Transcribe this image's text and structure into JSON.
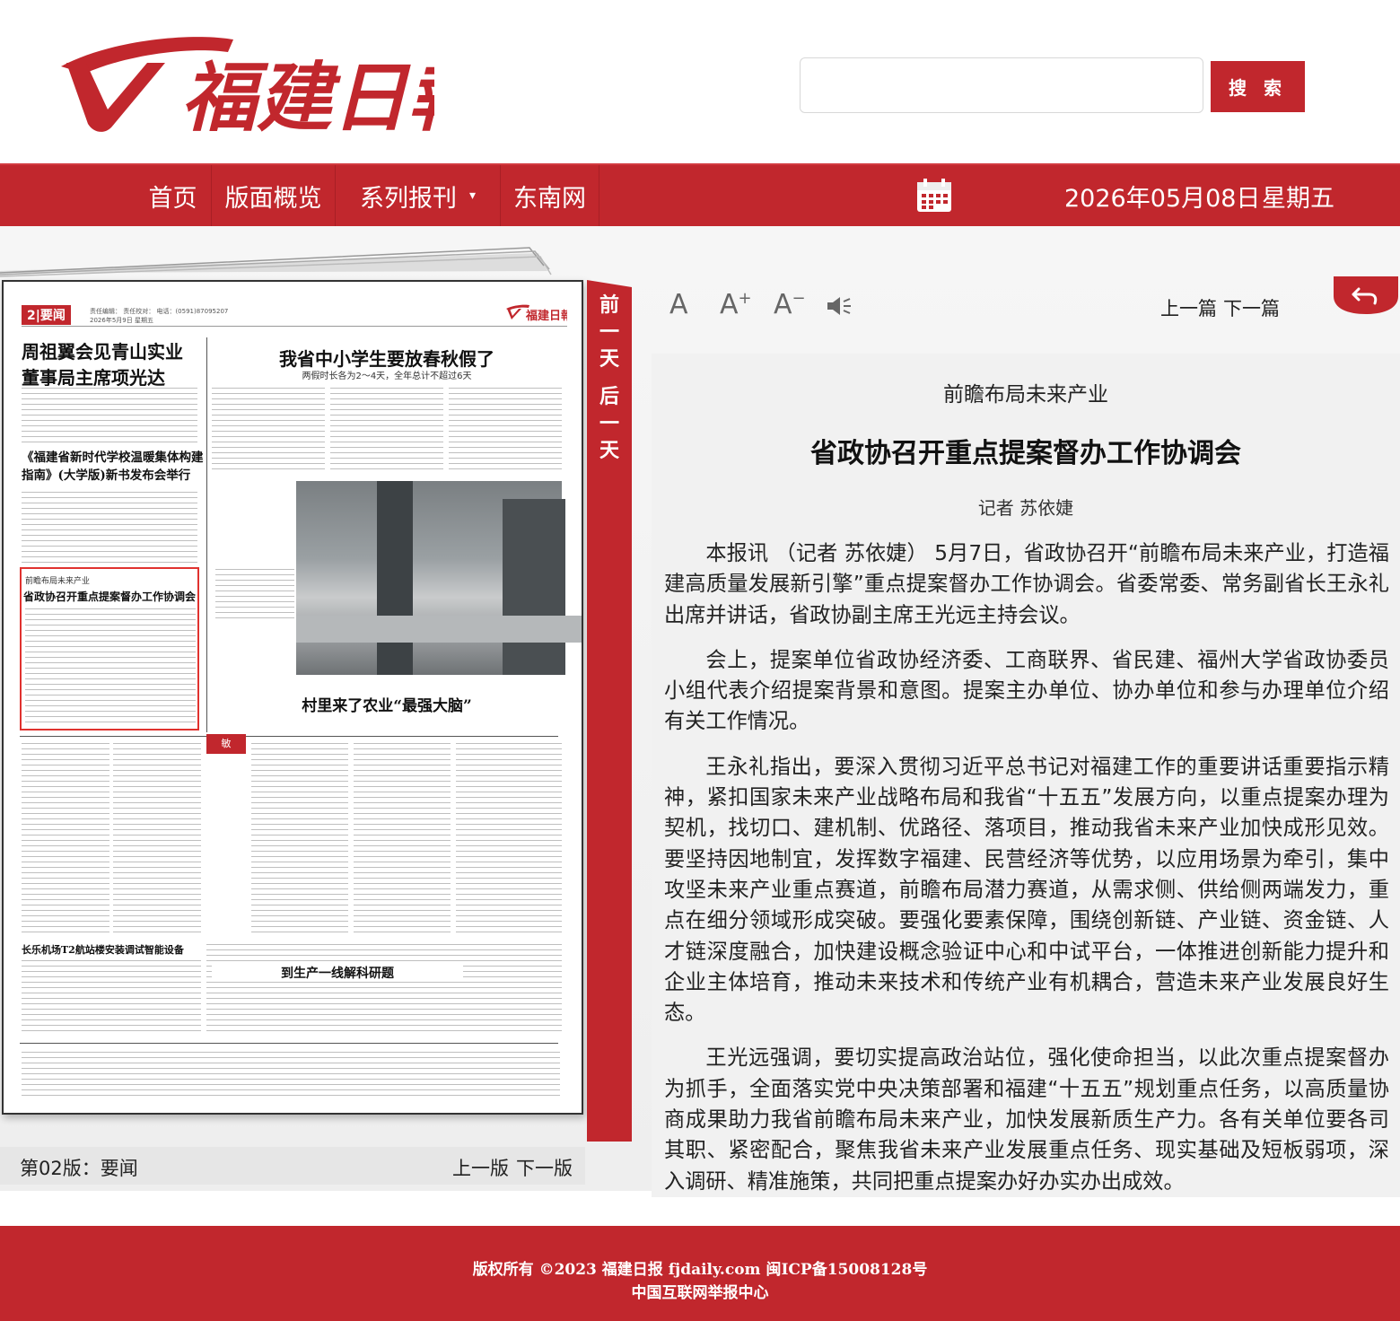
{
  "header": {
    "logo_text": "福建日報",
    "search_placeholder": "",
    "search_button": "搜 索"
  },
  "nav": {
    "items": [
      {
        "label": "首页"
      },
      {
        "label": "版面概览"
      },
      {
        "label": "系列报刊"
      },
      {
        "label": "东南网"
      }
    ],
    "date": "2026年05月08日",
    "weekday": "星期五"
  },
  "side_ribbon": [
    "前",
    "一",
    "天",
    "后",
    "一",
    "天"
  ],
  "paper_page": {
    "page_no": "2",
    "section": "要闻",
    "meta": "责任编辑：  责任校对：  电话：(0591)87095207",
    "date_line": "2026年5月9日  星期五",
    "headlines": {
      "h1_line1": "周祖翼会见青山实业",
      "h1_line2": "董事局主席项光达",
      "h2": "我省中小学生要放春秋假了",
      "h2_sub": "两假时长各为2～4天，全年总计不超过6天",
      "h3_line1": "《福建省新时代学校温暖集体构建",
      "h3_line2": "指南》(大学版)新书发布会举行",
      "h4_kicker": "前瞻布局未来产业",
      "h4": "省政协召开重点提案督办工作协调会",
      "h5": "村里来了农业“最强大脑”",
      "h6": "长乐机场T2航站楼安装调试智能设备",
      "h7": "到生产一线解科研题"
    }
  },
  "paper_footer": {
    "edition": "第02版：要闻",
    "prev": "上一版",
    "next": "下一版"
  },
  "article_toolbar": {
    "font_normal": "A",
    "font_plus": "A",
    "font_minus": "A",
    "prev": "上一篇",
    "next": "下一篇"
  },
  "article": {
    "kicker": "前瞻布局未来产业",
    "title": "省政协召开重点提案督办工作协调会",
    "byline": "记者 苏依婕",
    "paragraphs": [
      "本报讯 （记者 苏依婕） 5月7日，省政协召开“前瞻布局未来产业，打造福建高质量发展新引擎”重点提案督办工作协调会。省委常委、常务副省长王永礼出席并讲话，省政协副主席王光远主持会议。",
      "会上，提案单位省政协经济委、工商联界、省民建、福州大学省政协委员小组代表介绍提案背景和意图。提案主办单位、协办单位和参与办理单位介绍有关工作情况。",
      "王永礼指出，要深入贯彻习近平总书记对福建工作的重要讲话重要指示精神，紧扣国家未来产业战略布局和我省“十五五”发展方向，以重点提案办理为契机，找切口、建机制、优路径、落项目，推动我省未来产业加快成形见效。要坚持因地制宜，发挥数字福建、民营经济等优势，以应用场景为牵引，集中攻坚未来产业重点赛道，前瞻布局潜力赛道，从需求侧、供给侧两端发力，重点在细分领域形成突破。要强化要素保障，围绕创新链、产业链、资金链、人才链深度融合，加快建设概念验证中心和中试平台，一体推进创新能力提升和企业主体培育，推动未来技术和传统产业有机耦合，营造未来产业发展良好生态。",
      "王光远强调，要切实提高政治站位，强化使命担当，以此次重点提案督办为抓手，全面落实党中央决策部署和福建“十五五”规划重点任务，以高质量协商成果助力我省前瞻布局未来产业，加快发展新质生产力。各有关单位要各司其职、紧密配合，聚焦我省未来产业发展重点任务、现实基础及短板弱项，深入调研、精准施策，共同把重点提案办好办实办出成效。"
    ]
  },
  "footer": {
    "line1": "版权所有 ©2023 福建日报 fjdaily.com 闽ICP备15008128号",
    "line2": "中国互联网举报中心"
  },
  "colors": {
    "brand_red": "#c1272d",
    "highlight_red": "#e0322f"
  }
}
